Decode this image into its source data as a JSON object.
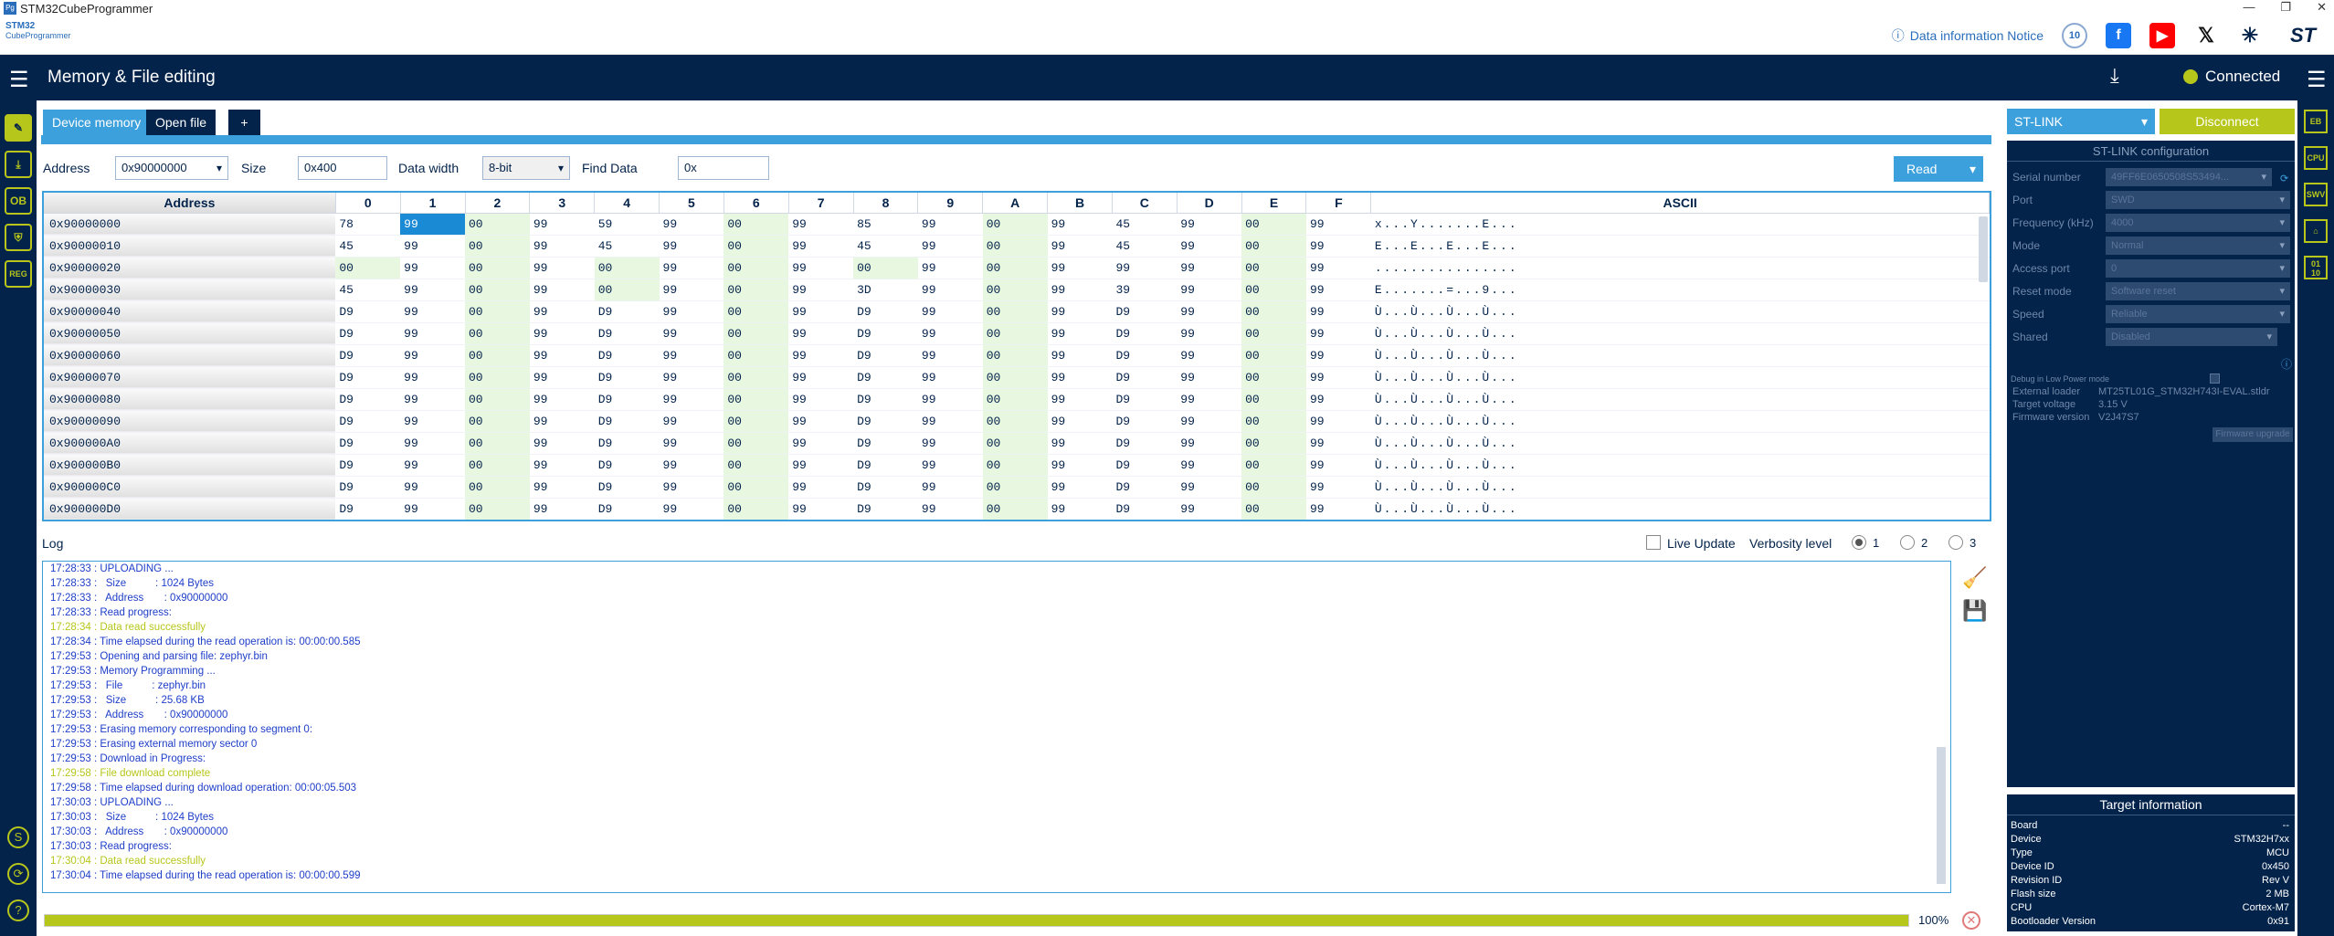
{
  "window": {
    "title": "STM32CubeProgrammer"
  },
  "brand": {
    "logo_line1": "STM32",
    "logo_line2": "CubeProgrammer",
    "notice": "Data information Notice",
    "anniversary": "10",
    "social": [
      "facebook-icon",
      "youtube-icon",
      "x-icon",
      "network-icon",
      "st-logo"
    ]
  },
  "header": {
    "title": "Memory & File editing",
    "status": "Connected"
  },
  "tabs": [
    "Device memory",
    "Open file",
    "+"
  ],
  "toolbar": {
    "address_label": "Address",
    "address_value": "0x90000000",
    "size_label": "Size",
    "size_value": "0x400",
    "width_label": "Data width",
    "width_value": "8-bit",
    "find_label": "Find Data",
    "find_value": "0x",
    "read_label": "Read"
  },
  "grid": {
    "headers": [
      "Address",
      "0",
      "1",
      "2",
      "3",
      "4",
      "5",
      "6",
      "7",
      "8",
      "9",
      "A",
      "B",
      "C",
      "D",
      "E",
      "F",
      "ASCII"
    ],
    "rows": [
      [
        "0x90000000",
        "78",
        "99",
        "00",
        "99",
        "59",
        "99",
        "00",
        "99",
        "85",
        "99",
        "00",
        "99",
        "45",
        "99",
        "00",
        "99",
        "x...Y.......E..."
      ],
      [
        "0x90000010",
        "45",
        "99",
        "00",
        "99",
        "45",
        "99",
        "00",
        "99",
        "45",
        "99",
        "00",
        "99",
        "45",
        "99",
        "00",
        "99",
        "E...E...E...E..."
      ],
      [
        "0x90000020",
        "00",
        "99",
        "00",
        "99",
        "00",
        "99",
        "00",
        "99",
        "00",
        "99",
        "00",
        "99",
        "99",
        "99",
        "00",
        "99",
        "................"
      ],
      [
        "0x90000030",
        "45",
        "99",
        "00",
        "99",
        "00",
        "99",
        "00",
        "99",
        "3D",
        "99",
        "00",
        "99",
        "39",
        "99",
        "00",
        "99",
        "E.......=...9..."
      ],
      [
        "0x90000040",
        "D9",
        "99",
        "00",
        "99",
        "D9",
        "99",
        "00",
        "99",
        "D9",
        "99",
        "00",
        "99",
        "D9",
        "99",
        "00",
        "99",
        "Ù...Ù...Ù...Ù..."
      ],
      [
        "0x90000050",
        "D9",
        "99",
        "00",
        "99",
        "D9",
        "99",
        "00",
        "99",
        "D9",
        "99",
        "00",
        "99",
        "D9",
        "99",
        "00",
        "99",
        "Ù...Ù...Ù...Ù..."
      ],
      [
        "0x90000060",
        "D9",
        "99",
        "00",
        "99",
        "D9",
        "99",
        "00",
        "99",
        "D9",
        "99",
        "00",
        "99",
        "D9",
        "99",
        "00",
        "99",
        "Ù...Ù...Ù...Ù..."
      ],
      [
        "0x90000070",
        "D9",
        "99",
        "00",
        "99",
        "D9",
        "99",
        "00",
        "99",
        "D9",
        "99",
        "00",
        "99",
        "D9",
        "99",
        "00",
        "99",
        "Ù...Ù...Ù...Ù..."
      ],
      [
        "0x90000080",
        "D9",
        "99",
        "00",
        "99",
        "D9",
        "99",
        "00",
        "99",
        "D9",
        "99",
        "00",
        "99",
        "D9",
        "99",
        "00",
        "99",
        "Ù...Ù...Ù...Ù..."
      ],
      [
        "0x90000090",
        "D9",
        "99",
        "00",
        "99",
        "D9",
        "99",
        "00",
        "99",
        "D9",
        "99",
        "00",
        "99",
        "D9",
        "99",
        "00",
        "99",
        "Ù...Ù...Ù...Ù..."
      ],
      [
        "0x900000A0",
        "D9",
        "99",
        "00",
        "99",
        "D9",
        "99",
        "00",
        "99",
        "D9",
        "99",
        "00",
        "99",
        "D9",
        "99",
        "00",
        "99",
        "Ù...Ù...Ù...Ù..."
      ],
      [
        "0x900000B0",
        "D9",
        "99",
        "00",
        "99",
        "D9",
        "99",
        "00",
        "99",
        "D9",
        "99",
        "00",
        "99",
        "D9",
        "99",
        "00",
        "99",
        "Ù...Ù...Ù...Ù..."
      ],
      [
        "0x900000C0",
        "D9",
        "99",
        "00",
        "99",
        "D9",
        "99",
        "00",
        "99",
        "D9",
        "99",
        "00",
        "99",
        "D9",
        "99",
        "00",
        "99",
        "Ù...Ù...Ù...Ù..."
      ],
      [
        "0x900000D0",
        "D9",
        "99",
        "00",
        "99",
        "D9",
        "99",
        "00",
        "99",
        "D9",
        "99",
        "00",
        "99",
        "D9",
        "99",
        "00",
        "99",
        "Ù...Ù...Ù...Ù..."
      ]
    ]
  },
  "log": {
    "label": "Log",
    "live_update": "Live Update",
    "verbosity_label": "Verbosity level",
    "levels": [
      "1",
      "2",
      "3"
    ],
    "lines": [
      {
        "t": "17:28:33 : UPLOADING ...",
        "ok": false
      },
      {
        "t": "17:28:33 :   Size          : 1024 Bytes",
        "ok": false
      },
      {
        "t": "17:28:33 :   Address       : 0x90000000",
        "ok": false
      },
      {
        "t": "17:28:33 : Read progress:",
        "ok": false
      },
      {
        "t": "17:28:34 : Data read successfully",
        "ok": true
      },
      {
        "t": "17:28:34 : Time elapsed during the read operation is: 00:00:00.585",
        "ok": false
      },
      {
        "t": "17:29:53 : Opening and parsing file: zephyr.bin",
        "ok": false
      },
      {
        "t": "17:29:53 : Memory Programming ...",
        "ok": false
      },
      {
        "t": "17:29:53 :   File          : zephyr.bin",
        "ok": false
      },
      {
        "t": "17:29:53 :   Size          : 25.68 KB",
        "ok": false
      },
      {
        "t": "17:29:53 :   Address       : 0x90000000",
        "ok": false
      },
      {
        "t": "17:29:53 : Erasing memory corresponding to segment 0:",
        "ok": false
      },
      {
        "t": "17:29:53 : Erasing external memory sector 0",
        "ok": false
      },
      {
        "t": "17:29:53 : Download in Progress:",
        "ok": false
      },
      {
        "t": "17:29:58 : File download complete",
        "ok": true
      },
      {
        "t": "17:29:58 : Time elapsed during download operation: 00:00:05.503",
        "ok": false
      },
      {
        "t": "17:30:03 : UPLOADING ...",
        "ok": false
      },
      {
        "t": "17:30:03 :   Size          : 1024 Bytes",
        "ok": false
      },
      {
        "t": "17:30:03 :   Address       : 0x90000000",
        "ok": false
      },
      {
        "t": "17:30:03 : Read progress:",
        "ok": false
      },
      {
        "t": "17:30:04 : Data read successfully",
        "ok": true
      },
      {
        "t": "17:30:04 : Time elapsed during the read operation is: 00:00:00.599",
        "ok": false
      }
    ]
  },
  "progress": {
    "value": 1.0,
    "label": "100%"
  },
  "stlink": {
    "select": "ST-LINK",
    "disconnect": "Disconnect",
    "config_title": "ST-LINK configuration",
    "fields": [
      {
        "label": "Serial number",
        "value": "49FF6E0650508S53494..."
      },
      {
        "label": "Port",
        "value": "SWD"
      },
      {
        "label": "Frequency (kHz)",
        "value": "4000"
      },
      {
        "label": "Mode",
        "value": "Normal"
      },
      {
        "label": "Access port",
        "value": "0"
      },
      {
        "label": "Reset mode",
        "value": "Software reset"
      },
      {
        "label": "Speed",
        "value": "Reliable"
      },
      {
        "label": "Shared",
        "value": "Disabled"
      }
    ],
    "debug_low_power": "Debug in Low Power mode",
    "ext_loader_label": "External loader",
    "ext_loader_value": "MT25TL01G_STM32H743I-EVAL.stldr",
    "voltage_label": "Target voltage",
    "voltage_value": "3.15 V",
    "fw_label": "Firmware version",
    "fw_value": "V2J47S7",
    "fw_upgrade": "Firmware upgrade"
  },
  "target": {
    "title": "Target information",
    "rows": [
      {
        "k": "Board",
        "v": "--"
      },
      {
        "k": "Device",
        "v": "STM32H7xx"
      },
      {
        "k": "Type",
        "v": "MCU"
      },
      {
        "k": "Device ID",
        "v": "0x450"
      },
      {
        "k": "Revision ID",
        "v": "Rev V"
      },
      {
        "k": "Flash size",
        "v": "2 MB"
      },
      {
        "k": "CPU",
        "v": "Cortex-M7"
      },
      {
        "k": "Bootloader Version",
        "v": "0x91"
      }
    ]
  },
  "right_icons": [
    "EB",
    "CPU",
    "SWV",
    "BELL",
    "0110"
  ],
  "colors": {
    "navy": "#03234b",
    "blue": "#3ca0dc",
    "lime": "#b7c61a"
  }
}
